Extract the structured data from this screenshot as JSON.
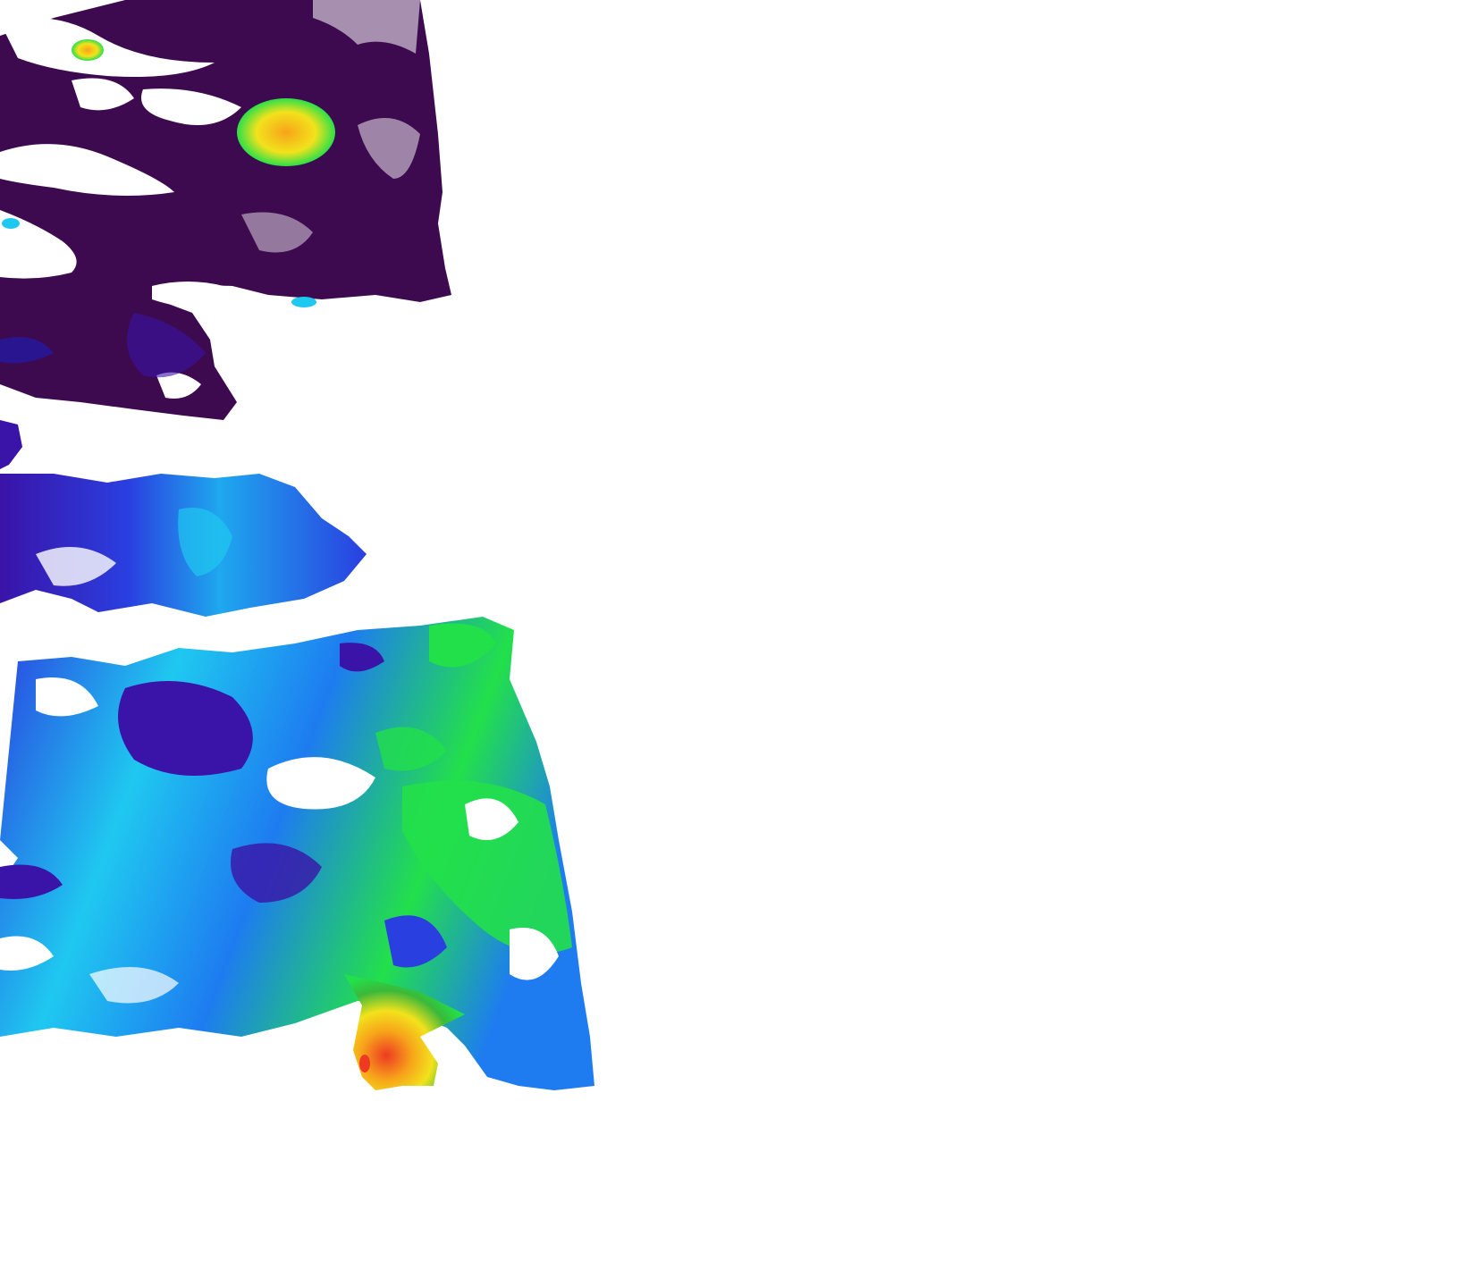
{
  "map": {
    "type": "satellite-swath",
    "background": "#ffffff",
    "colormap": [
      "#3d0a4f",
      "#3a13a8",
      "#2a3fe0",
      "#1e7cf0",
      "#1fc8f0",
      "#1ee6d2",
      "#22e04a",
      "#3bb83a",
      "#f2e21c",
      "#f7a41a",
      "#ee3a22"
    ],
    "regions": [
      {
        "name": "north-low-values",
        "dominant_color": "#3d0a4f"
      },
      {
        "name": "north-hotspot",
        "dominant_color": "#f2c01c"
      },
      {
        "name": "mid-band",
        "dominant_color": "#3a13a8"
      },
      {
        "name": "south-field",
        "dominant_color": "#1fc8f0"
      },
      {
        "name": "southeast-green-field",
        "dominant_color": "#22e04a"
      },
      {
        "name": "southern-hotspot",
        "dominant_color": "#f7a41a"
      }
    ]
  }
}
